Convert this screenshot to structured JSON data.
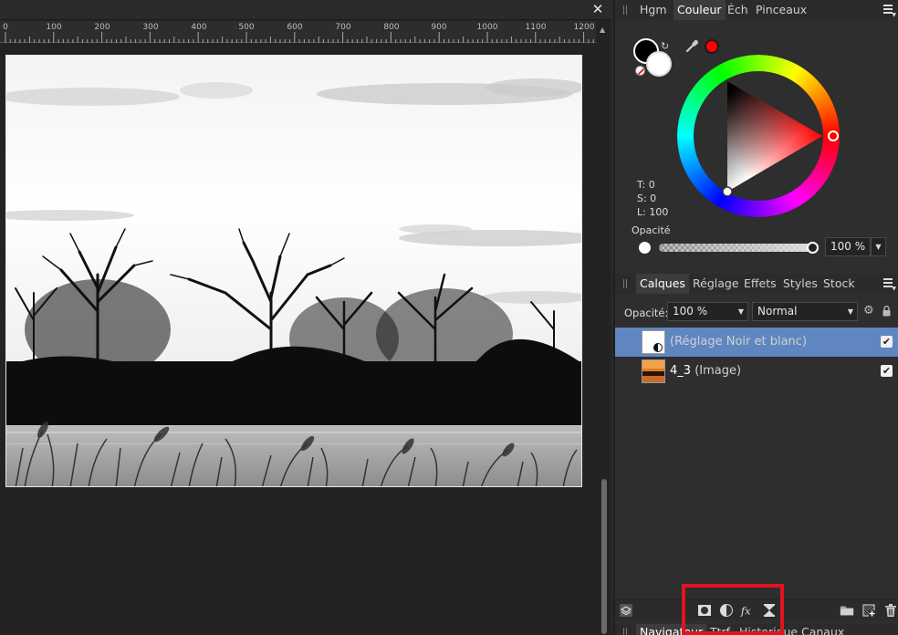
{
  "ruler": {
    "labels": [
      "0",
      "100",
      "200",
      "300",
      "400",
      "500",
      "600",
      "700",
      "800",
      "900",
      "1000",
      "1100",
      "1200"
    ]
  },
  "document": {
    "close_label": "✕"
  },
  "color_panel": {
    "tabs": [
      "Hgm",
      "Couleur",
      "Éch",
      "Pinceaux"
    ],
    "active_tab": "Couleur",
    "hue_color": "#ff0000",
    "fill_color": "#000000",
    "stroke_color": "#ffffff",
    "hsl_t": "T: 0",
    "hsl_s": "S: 0",
    "hsl_l": "L: 100",
    "opacity_label": "Opacité",
    "opacity_value": "100 %",
    "opacity_fraction": 1.0
  },
  "layers_panel": {
    "tabs": [
      "Calques",
      "Réglage",
      "Effets",
      "Styles",
      "Stock"
    ],
    "active_tab": "Calques",
    "opacity_label": "Opacité:",
    "opacity_value": "100 %",
    "blend_mode": "Normal",
    "layers": [
      {
        "name": "",
        "type": "(Réglage Noir et blanc)",
        "visible": true,
        "selected": true
      },
      {
        "name": "4_3",
        "type": "(Image)",
        "visible": true,
        "selected": false
      }
    ]
  },
  "bottom_panel": {
    "tabs": [
      "Navigateur",
      "Ttrf",
      "Historique",
      "Canaux"
    ]
  },
  "icons": {
    "footer": [
      "layers-icon",
      "mask-icon",
      "adjustment-icon",
      "fx-icon",
      "live-filter-icon",
      "folder-icon",
      "add-layer-icon",
      "trash-icon"
    ]
  }
}
